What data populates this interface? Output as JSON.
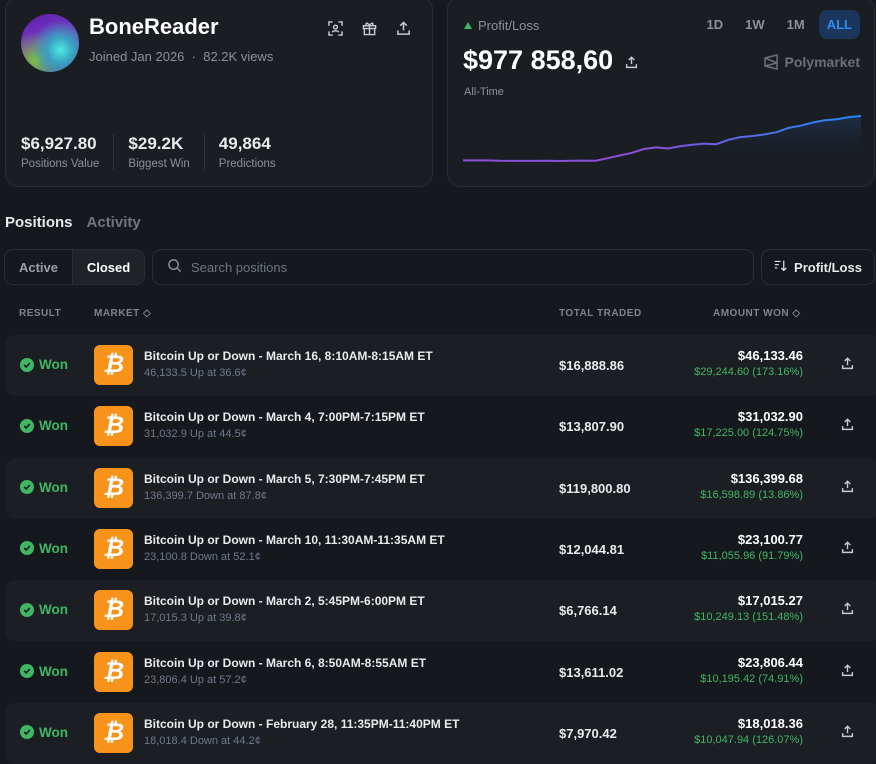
{
  "profile": {
    "username": "BoneReader",
    "joined": "Joined Jan 2026",
    "dot": "·",
    "views": "82.2K views",
    "stats": [
      {
        "value": "$6,927.80",
        "label": "Positions Value"
      },
      {
        "value": "$29.2K",
        "label": "Biggest Win"
      },
      {
        "value": "49,864",
        "label": "Predictions"
      }
    ]
  },
  "pnl": {
    "label": "Profit/Loss",
    "value": "$977 858,60",
    "period_label": "All-Time",
    "brand": "Polymarket",
    "ranges": [
      "1D",
      "1W",
      "1M",
      "ALL"
    ],
    "active_range": "ALL",
    "colors": {
      "start": "#8b4fd8",
      "end": "#1e88f5",
      "up": "#3fb764"
    }
  },
  "chart_data": {
    "type": "line",
    "title": "Profit/Loss",
    "xlabel": "",
    "ylabel": "",
    "values": [
      0,
      0,
      0,
      -8000,
      -10000,
      -10000,
      -10000,
      -8000,
      -11000,
      -8000,
      -3000,
      -6000,
      40000,
      90000,
      140000,
      210000,
      240000,
      220000,
      260000,
      290000,
      310000,
      300000,
      380000,
      430000,
      450000,
      480000,
      520000,
      600000,
      640000,
      700000,
      740000,
      760000,
      800000,
      820000
    ]
  },
  "tabs": [
    "Positions",
    "Activity"
  ],
  "filters": {
    "active": "Active",
    "closed": "Closed",
    "search_placeholder": "Search positions",
    "sort": "Profit/Loss"
  },
  "columns": {
    "result": "RESULT",
    "market": "MARKET",
    "total": "TOTAL TRADED",
    "won": "AMOUNT WON"
  },
  "rows": [
    {
      "result": "Won",
      "title": "Bitcoin Up or Down - March 16, 8:10AM-8:15AM ET",
      "sub": "46,133.5 Up at 36.6¢",
      "total": "$16,888.86",
      "won": "$46,133.46",
      "profit": "$29,244.60 (173.16%)"
    },
    {
      "result": "Won",
      "title": "Bitcoin Up or Down - March 4, 7:00PM-7:15PM ET",
      "sub": "31,032.9 Up at 44.5¢",
      "total": "$13,807.90",
      "won": "$31,032.90",
      "profit": "$17,225.00 (124.75%)"
    },
    {
      "result": "Won",
      "title": "Bitcoin Up or Down - March 5, 7:30PM-7:45PM ET",
      "sub": "136,399.7 Down at 87.8¢",
      "total": "$119,800.80",
      "won": "$136,399.68",
      "profit": "$16,598.89 (13.86%)"
    },
    {
      "result": "Won",
      "title": "Bitcoin Up or Down - March 10, 11:30AM-11:35AM ET",
      "sub": "23,100.8 Down at 52.1¢",
      "total": "$12,044.81",
      "won": "$23,100.77",
      "profit": "$11,055.96 (91.79%)"
    },
    {
      "result": "Won",
      "title": "Bitcoin Up or Down - March 2, 5:45PM-6:00PM ET",
      "sub": "17,015.3 Up at 39.8¢",
      "total": "$6,766.14",
      "won": "$17,015.27",
      "profit": "$10,249.13 (151.48%)"
    },
    {
      "result": "Won",
      "title": "Bitcoin Up or Down - March 6, 8:50AM-8:55AM ET",
      "sub": "23,806.4 Up at 57.2¢",
      "total": "$13,611.02",
      "won": "$23,806.44",
      "profit": "$10,195.42 (74.91%)"
    },
    {
      "result": "Won",
      "title": "Bitcoin Up or Down - February 28, 11:35PM-11:40PM ET",
      "sub": "18,018.4 Down at 44.2¢",
      "total": "$7,970.42",
      "won": "$18,018.36",
      "profit": "$10,047.94 (126.07%)"
    }
  ]
}
